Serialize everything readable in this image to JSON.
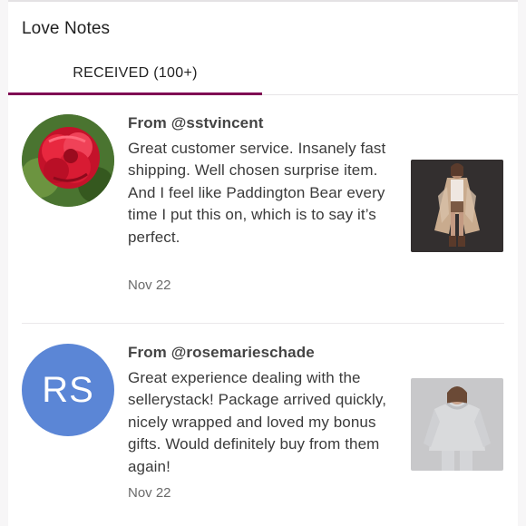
{
  "header": {
    "title": "Love Notes"
  },
  "tabs": [
    {
      "label": "RECEIVED (100+)",
      "active": true
    }
  ],
  "colors": {
    "accent": "#7f0353",
    "avatar_initials_bg": "#5b86d6"
  },
  "notes": [
    {
      "from": "From @sstvincent",
      "text": "Great customer service. Insanely fast shipping. Well chosen surprise item. And I feel like Paddington Bear every time I put this on, which is to say it’s perfect.",
      "date": "Nov 22",
      "avatar_type": "photo"
    },
    {
      "from": "From @rosemarieschade",
      "text": "Great experience dealing with the sellerystack! Package arrived quickly, nicely wrapped and loved my bonus gifts. Would definitely buy from them again!",
      "date": "Nov 22",
      "avatar_initials": "RS"
    }
  ]
}
